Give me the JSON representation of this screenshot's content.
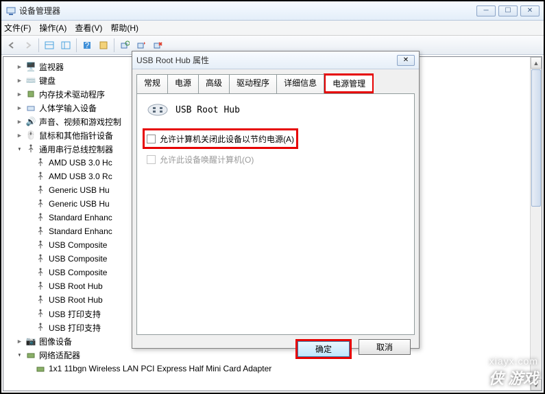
{
  "window": {
    "title": "设备管理器",
    "menu": {
      "file": "文件(F)",
      "action": "操作(A)",
      "view": "查看(V)",
      "help": "帮助(H)"
    }
  },
  "tree": {
    "items": [
      {
        "icon": "monitors",
        "label": "监视器",
        "expandable": true
      },
      {
        "icon": "keyboard",
        "label": "键盘",
        "expandable": true
      },
      {
        "icon": "chip",
        "label": "内存技术驱动程序",
        "expandable": true
      },
      {
        "icon": "hid",
        "label": "人体学输入设备",
        "expandable": true
      },
      {
        "icon": "sound",
        "label": "声音、视频和游戏控制",
        "expandable": true
      },
      {
        "icon": "mouse",
        "label": "鼠标和其他指针设备",
        "expandable": true
      }
    ],
    "usb": {
      "label": "通用串行总线控制器",
      "children": [
        "AMD USB 3.0 Hc",
        "AMD USB 3.0 Rc",
        "Generic USB Hu",
        "Generic USB Hu",
        "Standard Enhanc",
        "Standard Enhanc",
        "USB Composite",
        "USB Composite",
        "USB Composite",
        "USB Root Hub",
        "USB Root Hub",
        "USB 打印支持",
        "USB 打印支持"
      ]
    },
    "imaging": {
      "label": "图像设备"
    },
    "network": {
      "label": "网络适配器",
      "child": "1x1 11bgn Wireless LAN PCI Express Half Mini Card Adapter"
    }
  },
  "dialog": {
    "title": "USB Root Hub 属性",
    "tabs": [
      "常规",
      "电源",
      "高级",
      "驱动程序",
      "详细信息",
      "电源管理"
    ],
    "active_tab": 5,
    "device_name": "USB Root Hub",
    "cb1": "允许计算机关闭此设备以节约电源(A)",
    "cb2": "允许此设备唤醒计算机(O)",
    "ok": "确定",
    "cancel": "取消"
  },
  "watermark": {
    "site": "xiayx.com",
    "cn": "侠 游戏"
  }
}
